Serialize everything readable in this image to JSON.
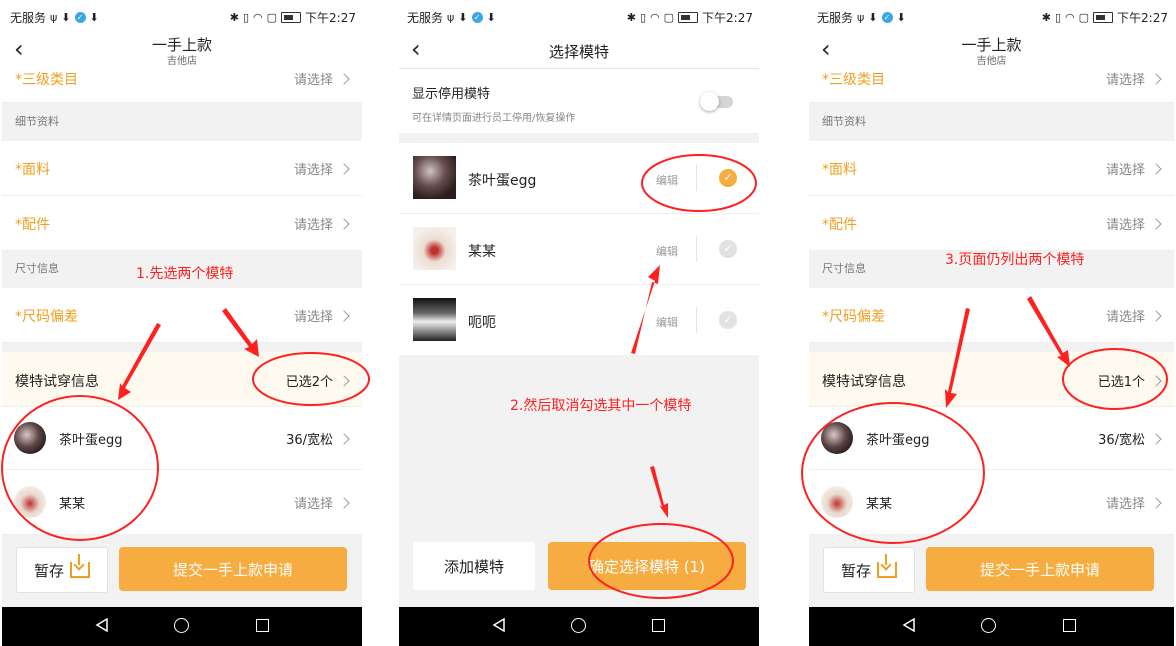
{
  "status": {
    "carrier": "无服务",
    "time": "下午2:27"
  },
  "screen1": {
    "title": "一手上款",
    "subtitle": "吉他店",
    "rows": {
      "category3": {
        "label": "*三级类目",
        "value": "请选择"
      },
      "fabric": {
        "label": "*面料",
        "value": "请选择"
      },
      "accessory": {
        "label": "*配件",
        "value": "请选择"
      },
      "size_bias": {
        "label": "*尺码偏差",
        "value": "请选择"
      },
      "model_info": {
        "label": "模特试穿信息",
        "value": "已选2个"
      }
    },
    "sections": {
      "detail": "细节资料",
      "size": "尺寸信息"
    },
    "models": [
      {
        "name": "茶叶蛋egg",
        "value": "36/宽松"
      },
      {
        "name": "某某",
        "value": "请选择"
      }
    ],
    "save_label": "暂存",
    "submit_label": "提交一手上款申请"
  },
  "screen2": {
    "title": "选择模特",
    "toggle_label": "显示停用模特",
    "toggle_hint": "可在详情页面进行员工停用/恢复操作",
    "toggle_on": false,
    "models": [
      {
        "name": "茶叶蛋egg",
        "edit": "编辑",
        "checked": true
      },
      {
        "name": "某某",
        "edit": "编辑",
        "checked": false
      },
      {
        "name": "呃呃",
        "edit": "编辑",
        "checked": false
      }
    ],
    "add_label": "添加模特",
    "confirm_label": "确定选择模特 (1)"
  },
  "screen3": {
    "title": "一手上款",
    "subtitle": "吉他店",
    "rows": {
      "category3": {
        "label": "*三级类目",
        "value": "请选择"
      },
      "fabric": {
        "label": "*面料",
        "value": "请选择"
      },
      "accessory": {
        "label": "*配件",
        "value": "请选择"
      },
      "size_bias": {
        "label": "*尺码偏差",
        "value": "请选择"
      },
      "model_info": {
        "label": "模特试穿信息",
        "value": "已选1个"
      }
    },
    "sections": {
      "detail": "细节资料",
      "size": "尺寸信息"
    },
    "models": [
      {
        "name": "茶叶蛋egg",
        "value": "36/宽松"
      },
      {
        "name": "某某",
        "value": "请选择"
      }
    ],
    "save_label": "暂存",
    "submit_label": "提交一手上款申请"
  },
  "annotations": {
    "step1": "1.先选两个模特",
    "step2": "2.然后取消勾选其中一个模特",
    "step3": "3.页面仍列出两个模特"
  },
  "colors": {
    "accent": "#f6ac40",
    "required": "#f0a020",
    "annotation": "#ff2020"
  }
}
